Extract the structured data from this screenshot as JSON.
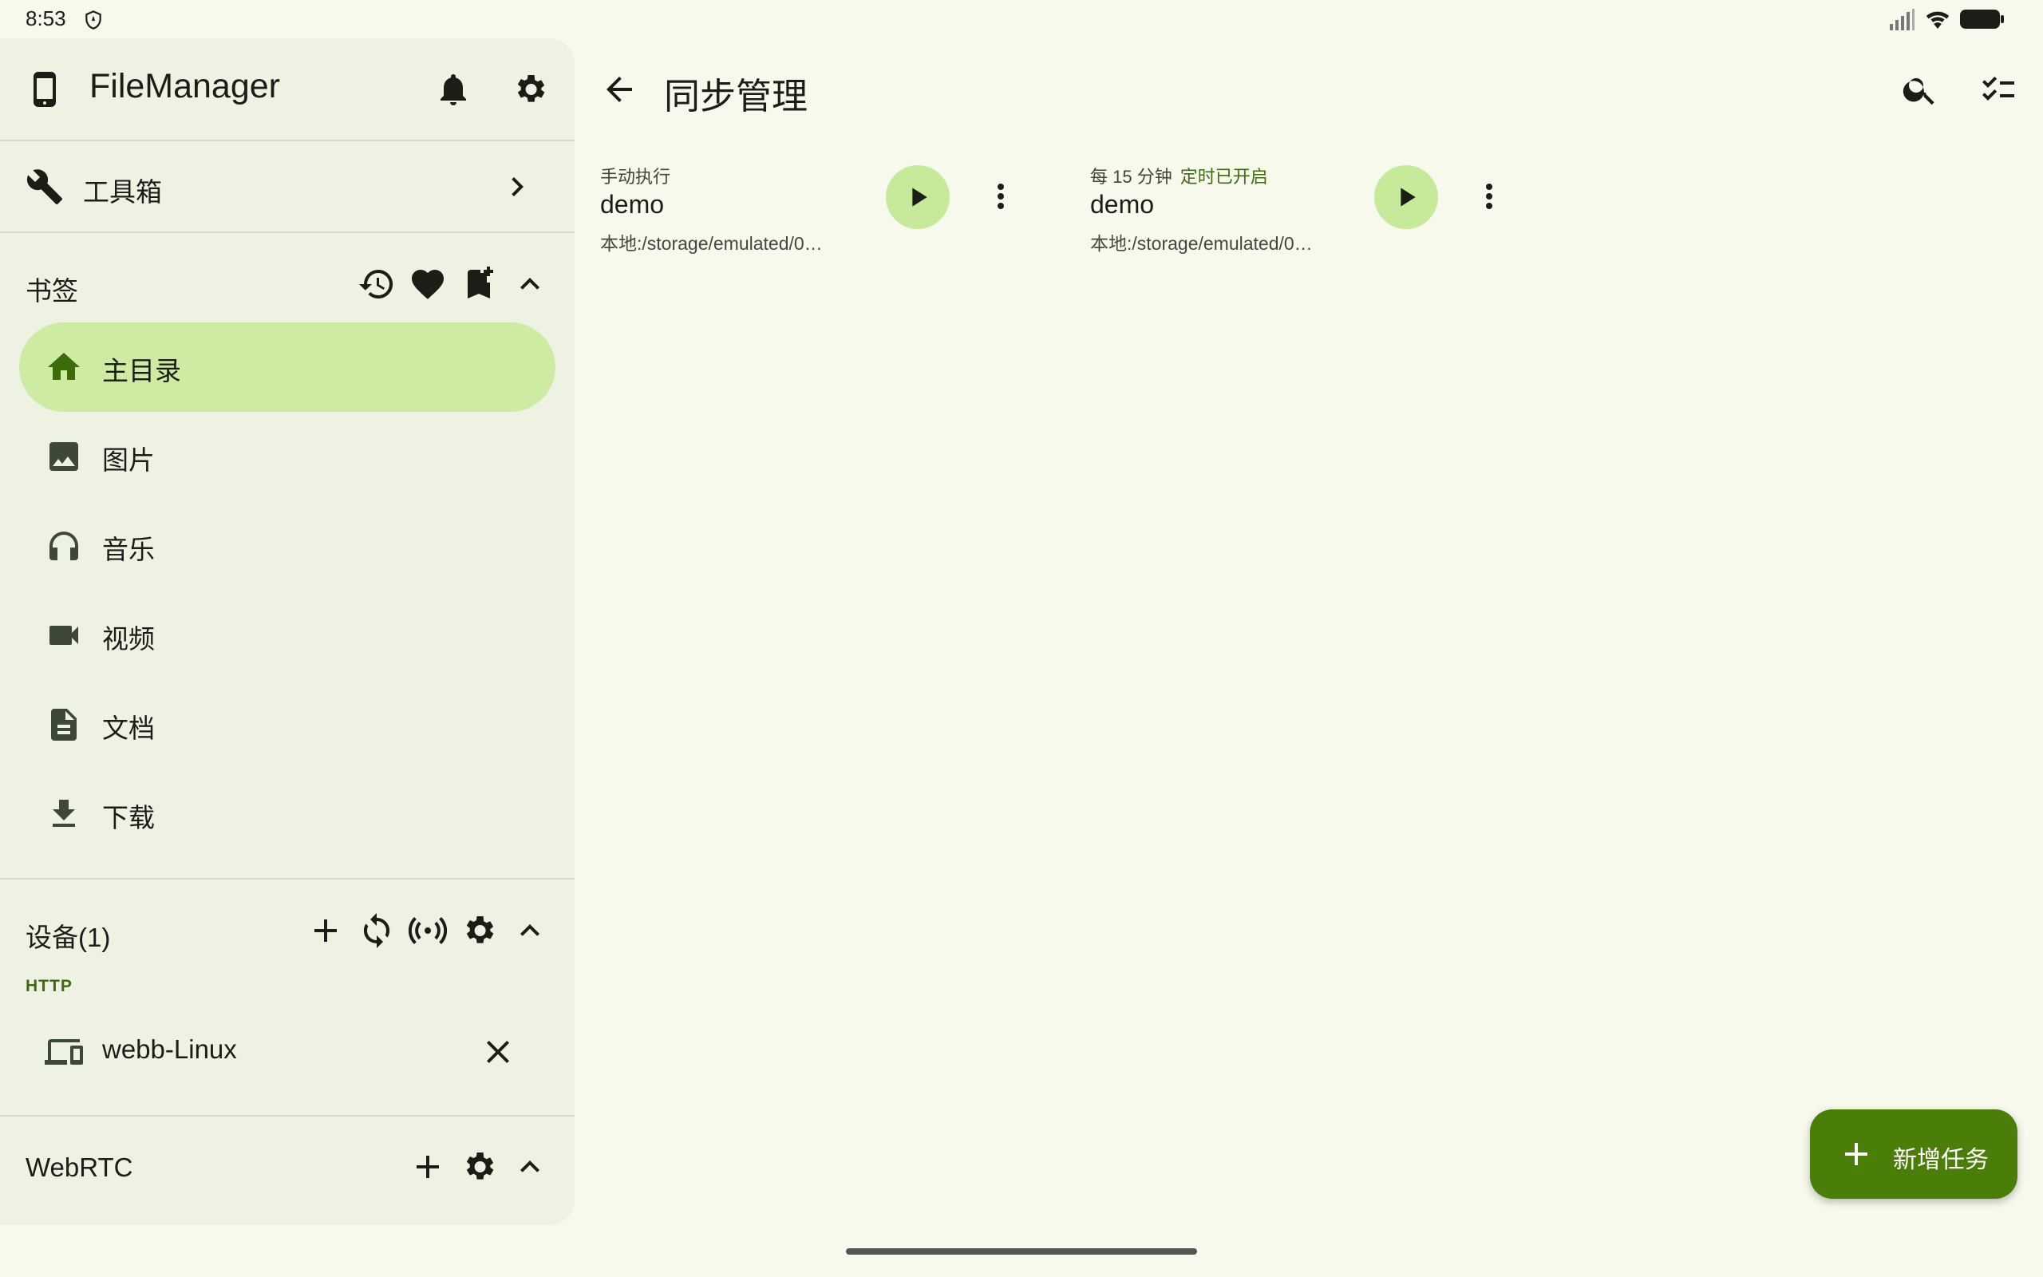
{
  "status_bar": {
    "time": "8:53"
  },
  "sidebar": {
    "app_title": "FileManager",
    "toolbox": {
      "label": "工具箱"
    },
    "bookmarks": {
      "title": "书签",
      "items": [
        {
          "label": "主目录",
          "icon": "home-icon",
          "active": true
        },
        {
          "label": "图片",
          "icon": "image-icon"
        },
        {
          "label": "音乐",
          "icon": "headphones-icon"
        },
        {
          "label": "视频",
          "icon": "videocam-icon"
        },
        {
          "label": "文档",
          "icon": "document-icon"
        },
        {
          "label": "下载",
          "icon": "download-icon"
        }
      ]
    },
    "devices": {
      "title": "设备(1)",
      "group_label": "HTTP",
      "items": [
        {
          "label": "webb-Linux",
          "icon": "devices-icon"
        }
      ]
    },
    "webrtc": {
      "title": "WebRTC"
    }
  },
  "main": {
    "title": "同步管理",
    "tasks": [
      {
        "schedule": "手动执行",
        "status": "",
        "name": "demo",
        "path": "本地:/storage/emulated/0…"
      },
      {
        "schedule": "每 15 分钟",
        "status": "定时已开启",
        "name": "demo",
        "path": "本地:/storage/emulated/0…"
      }
    ],
    "fab_label": "新增任务"
  },
  "colors": {
    "background": "#f6f9ec",
    "sidebar": "#eef2e2",
    "active_nav": "#cdeba2",
    "play_button": "#c6e99a",
    "fab": "#4a7e08",
    "accent_text": "#3f6a10"
  }
}
